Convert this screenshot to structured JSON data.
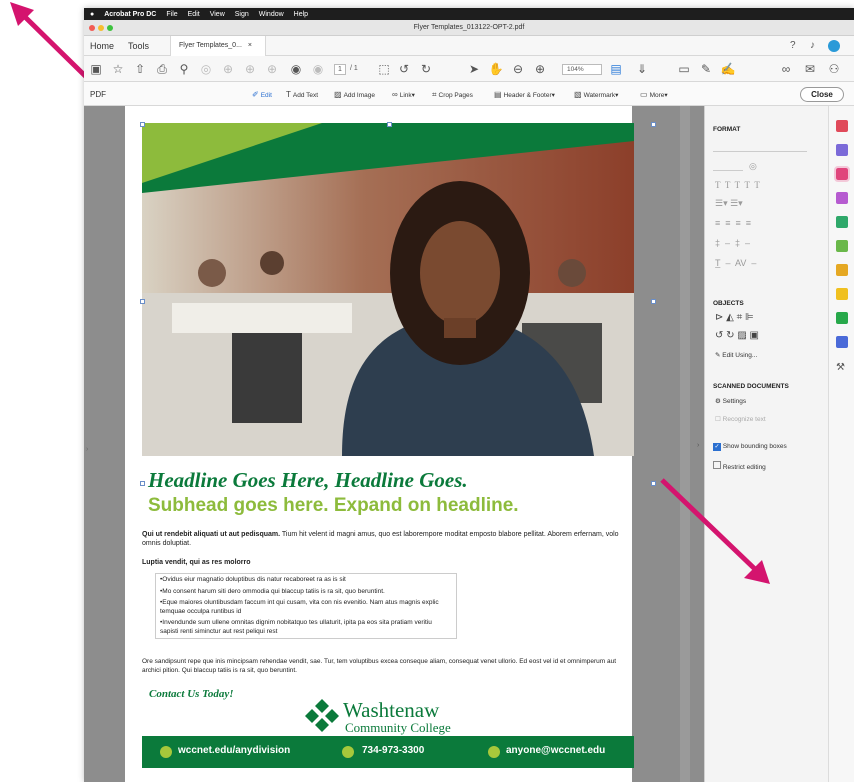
{
  "menubar": {
    "app": "Acrobat Pro DC",
    "items": [
      "File",
      "Edit",
      "View",
      "Sign",
      "Window",
      "Help"
    ]
  },
  "window": {
    "title": "Flyer Templates_013122-OPT-2.pdf"
  },
  "tabs": {
    "home": "Home",
    "tools": "Tools",
    "doc": "Flyer Templates_0...",
    "close": "×"
  },
  "toolbar": {
    "page_current": "1",
    "page_total": "/ 1",
    "zoom": "104%"
  },
  "editbar": {
    "left_label": "PDF",
    "items": [
      "Edit",
      "Add Text",
      "Add Image",
      "Link",
      "Crop Pages",
      "Header & Footer",
      "Watermark",
      "More"
    ],
    "close": "Close"
  },
  "right_panel": {
    "format_title": "FORMAT",
    "objects_title": "OBJECTS",
    "edit_using": "Edit Using...",
    "scanned_title": "SCANNED DOCUMENTS",
    "settings": "Settings",
    "recognize": "Recognize text",
    "show_bbox": "Show bounding boxes",
    "restrict": "Restrict editing"
  },
  "flyer": {
    "headline": "Headline Goes Here, Headline Goes.",
    "subhead": "Subhead goes here. Expand on headline.",
    "intro_bold": "Qui ut rendebit aliquati ut aut pedisquam.",
    "intro_rest": " Tium hit velent id magni amus, quo est laborempore moditat emposto blabore pellitat. Aborem erfernam, volo omnis doluptiat.",
    "list_title": "Luptia vendit, qui as res molorro",
    "bullets": [
      "•Ovidus eiur magnatio doluptibus dis natur recaboreet ra as is sit",
      "•Mo consent harum siti dero ommodia qui blaccup tatiis is ra sit, quo beruntint.",
      "•Eque maiores oluntibusdam faccum int qui cusam, vita con nis evenitio. Nam atus magnis explic temquae occulpa runtibus id",
      "•Invendunde sum ullene omnitas dignim nobitatquo tes ullaturit, ipita pa eos sita pratiam veritiu sapisti renti siminctur aut rest peliqui rest"
    ],
    "paragraph": "Ore sandipsunt repe que inis mincipsam rehendae vendit, sae. Tur, tem voluptibus excea conseque aliam, consequat venet ullorio. Ed eost vel id et omnimperum aut archici pition. Qui blaccup tatiis is ra sit, quo beruntint.",
    "contact": "Contact Us Today!",
    "logo_name": "Washtenaw",
    "logo_sub": "Community College",
    "footer": {
      "web": "wccnet.edu/anydivision",
      "phone": "734-973-3300",
      "email": "anyone@wccnet.edu"
    }
  },
  "colors": {
    "green": "#0b7a3b",
    "lime": "#8dbb3c",
    "arrow": "#d4146e"
  }
}
